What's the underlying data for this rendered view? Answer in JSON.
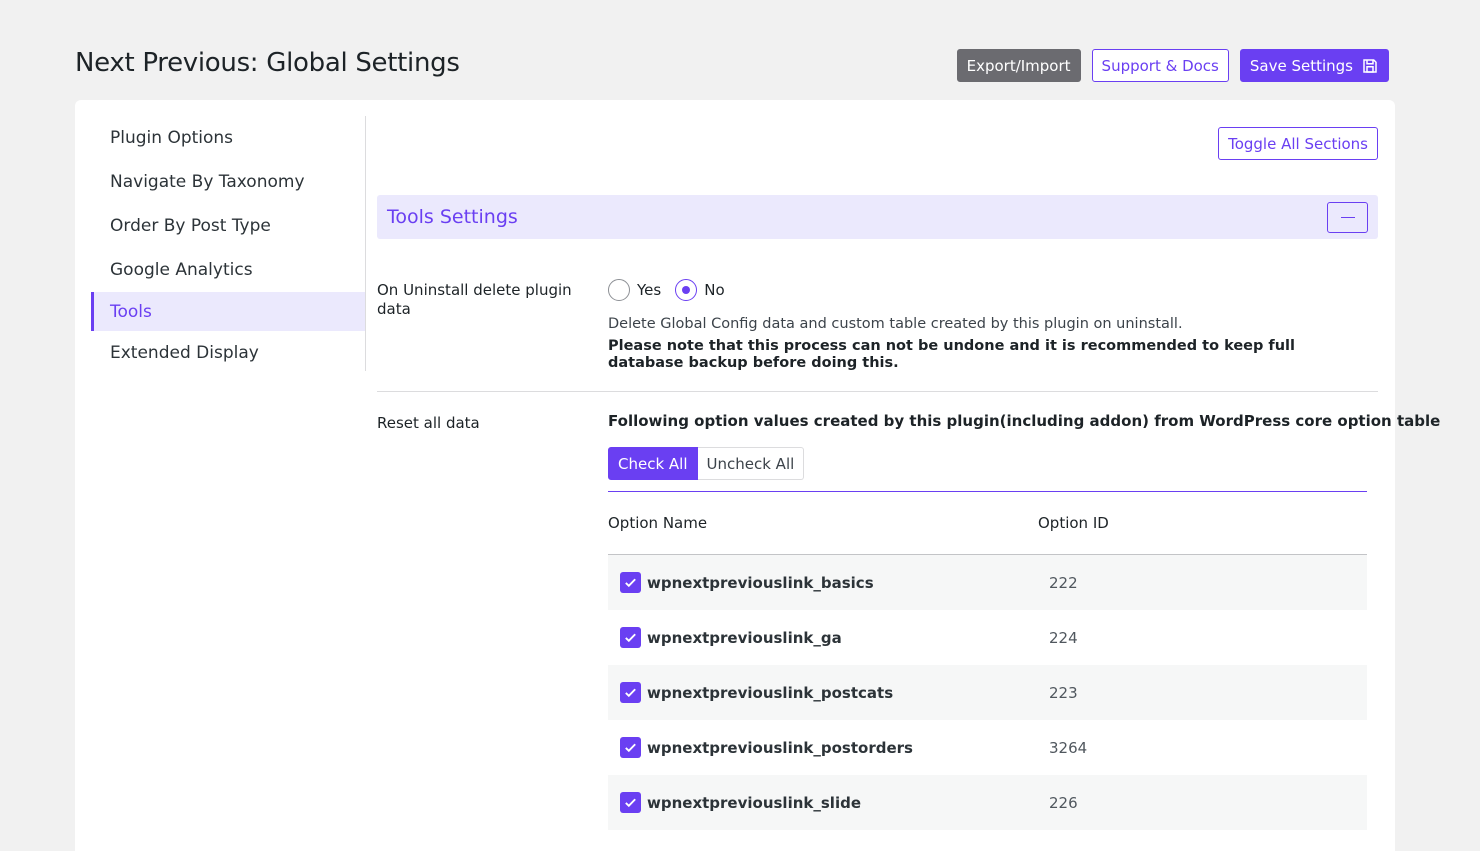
{
  "page": {
    "title": "Next Previous: Global Settings"
  },
  "top_actions": {
    "export_label": "Export/Import",
    "support_label": "Support & Docs",
    "save_label": "Save Settings"
  },
  "sidebar": {
    "items": [
      {
        "label": "Plugin Options",
        "active": false
      },
      {
        "label": "Navigate By Taxonomy",
        "active": false
      },
      {
        "label": "Order By Post Type",
        "active": false
      },
      {
        "label": "Google Analytics",
        "active": false
      },
      {
        "label": "Tools",
        "active": true
      },
      {
        "label": "Extended Display",
        "active": false
      }
    ]
  },
  "main": {
    "toggle_all_label": "Toggle All Sections",
    "section_title": "Tools Settings",
    "uninstall": {
      "label": "On Uninstall delete plugin data",
      "options": [
        "Yes",
        "No"
      ],
      "selected": "No",
      "description": "Delete Global Config data and custom table created by this plugin on uninstall.",
      "warning": "Please note that this process can not be undone and it is recommended to keep full database backup before doing this."
    },
    "reset": {
      "label": "Reset all data",
      "note": "Following option values created by this plugin(including addon) from WordPress core option table",
      "check_all_label": "Check All",
      "uncheck_all_label": "Uncheck All",
      "columns": [
        "Option Name",
        "Option ID"
      ],
      "rows": [
        {
          "name": "wpnextpreviouslink_basics",
          "id": "222",
          "checked": true
        },
        {
          "name": "wpnextpreviouslink_ga",
          "id": "224",
          "checked": true
        },
        {
          "name": "wpnextpreviouslink_postcats",
          "id": "223",
          "checked": true
        },
        {
          "name": "wpnextpreviouslink_postorders",
          "id": "3264",
          "checked": true
        },
        {
          "name": "wpnextpreviouslink_slide",
          "id": "226",
          "checked": true
        }
      ]
    }
  },
  "colors": {
    "accent": "#6a3ff2",
    "accent_light": "#ebe9fd",
    "gray_button": "#6b6b70"
  }
}
